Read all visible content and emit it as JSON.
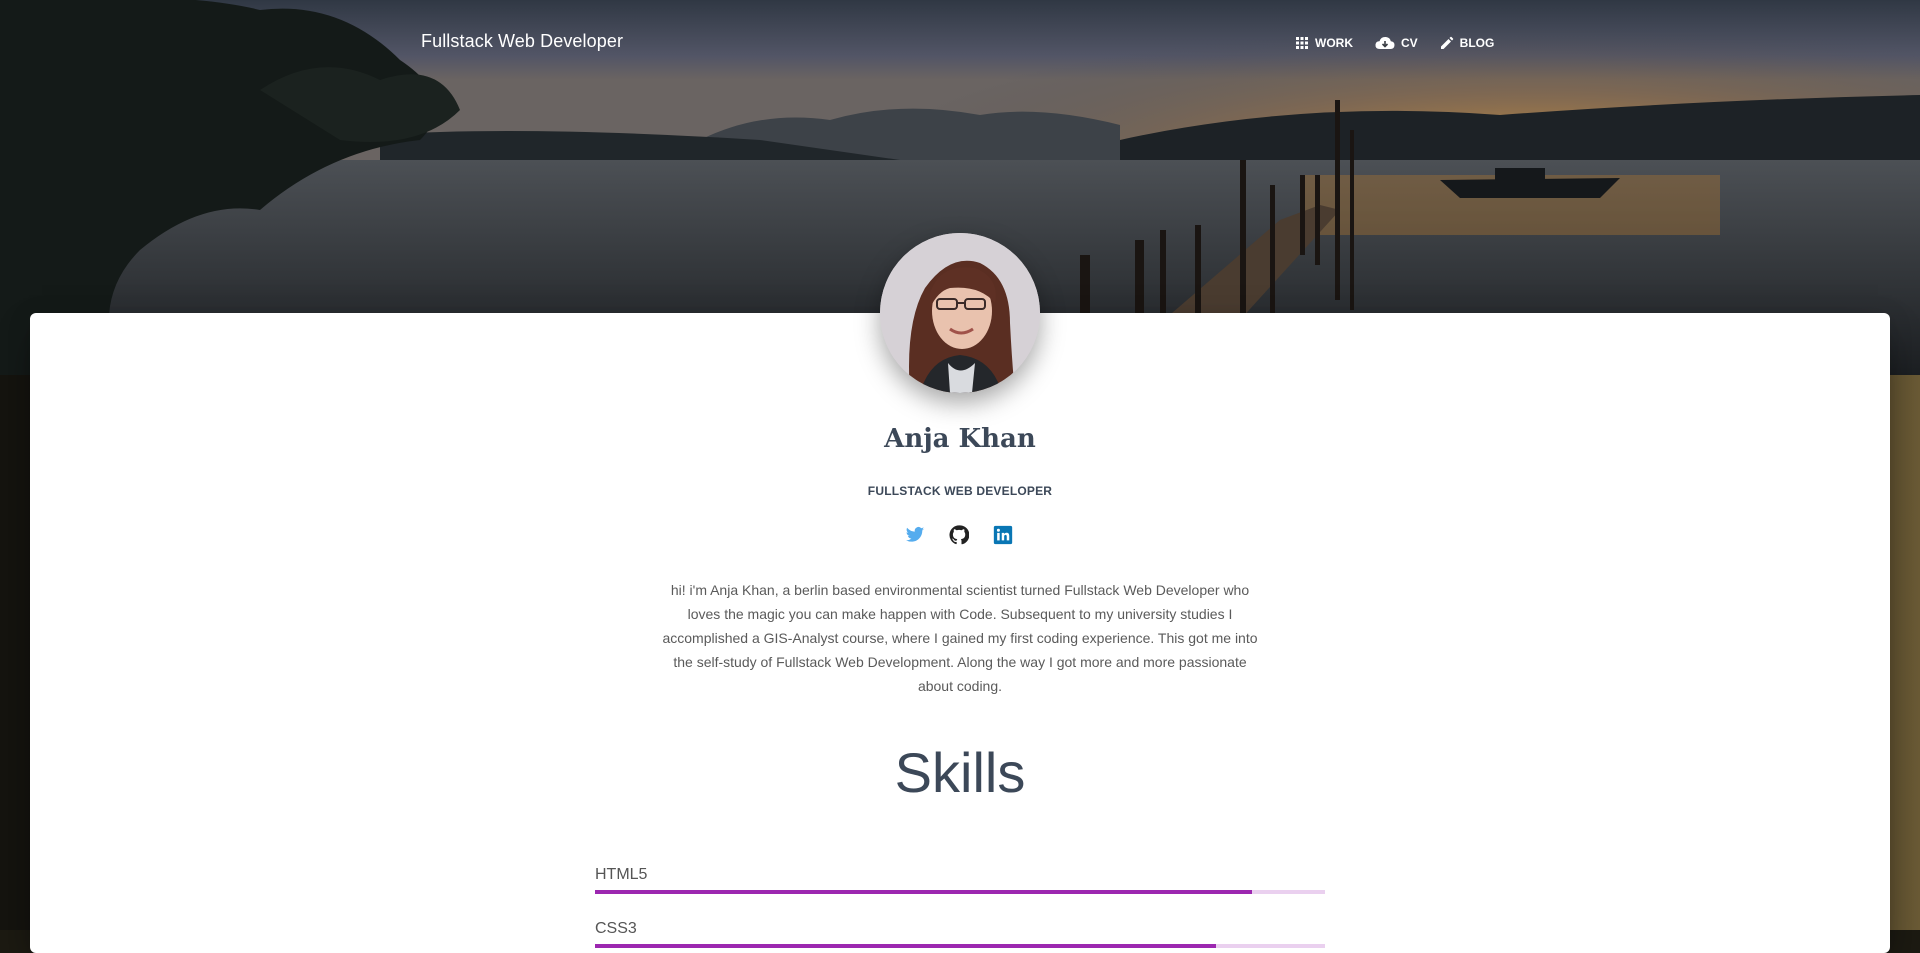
{
  "header": {
    "brand": "Fullstack Web Developer",
    "nav": [
      {
        "label": "WORK",
        "icon": "apps-icon"
      },
      {
        "label": "CV",
        "icon": "cloud-download-icon"
      },
      {
        "label": "BLOG",
        "icon": "pencil-icon"
      }
    ]
  },
  "profile": {
    "name": "Anja Khan",
    "title": "FULLSTACK WEB DEVELOPER",
    "social": [
      "twitter-icon",
      "github-icon",
      "linkedin-icon"
    ],
    "bio": "hi! i'm Anja Khan, a berlin based environmental scientist turned Fullstack Web Developer who loves the magic you can make happen with Code. Subsequent to my university studies I accomplished a GIS-Analyst course, where I gained my first coding experience. This got me into the self-study of Fullstack Web Development. Along the way I got more and more passionate about coding."
  },
  "skills": {
    "heading": "Skills",
    "items": [
      {
        "label": "HTML5",
        "percent": 90
      },
      {
        "label": "CSS3",
        "percent": 85
      }
    ]
  },
  "colors": {
    "accent": "#9c27b0",
    "text_dark": "#3c4858",
    "twitter": "#55acee",
    "linkedin": "#0976b4"
  }
}
